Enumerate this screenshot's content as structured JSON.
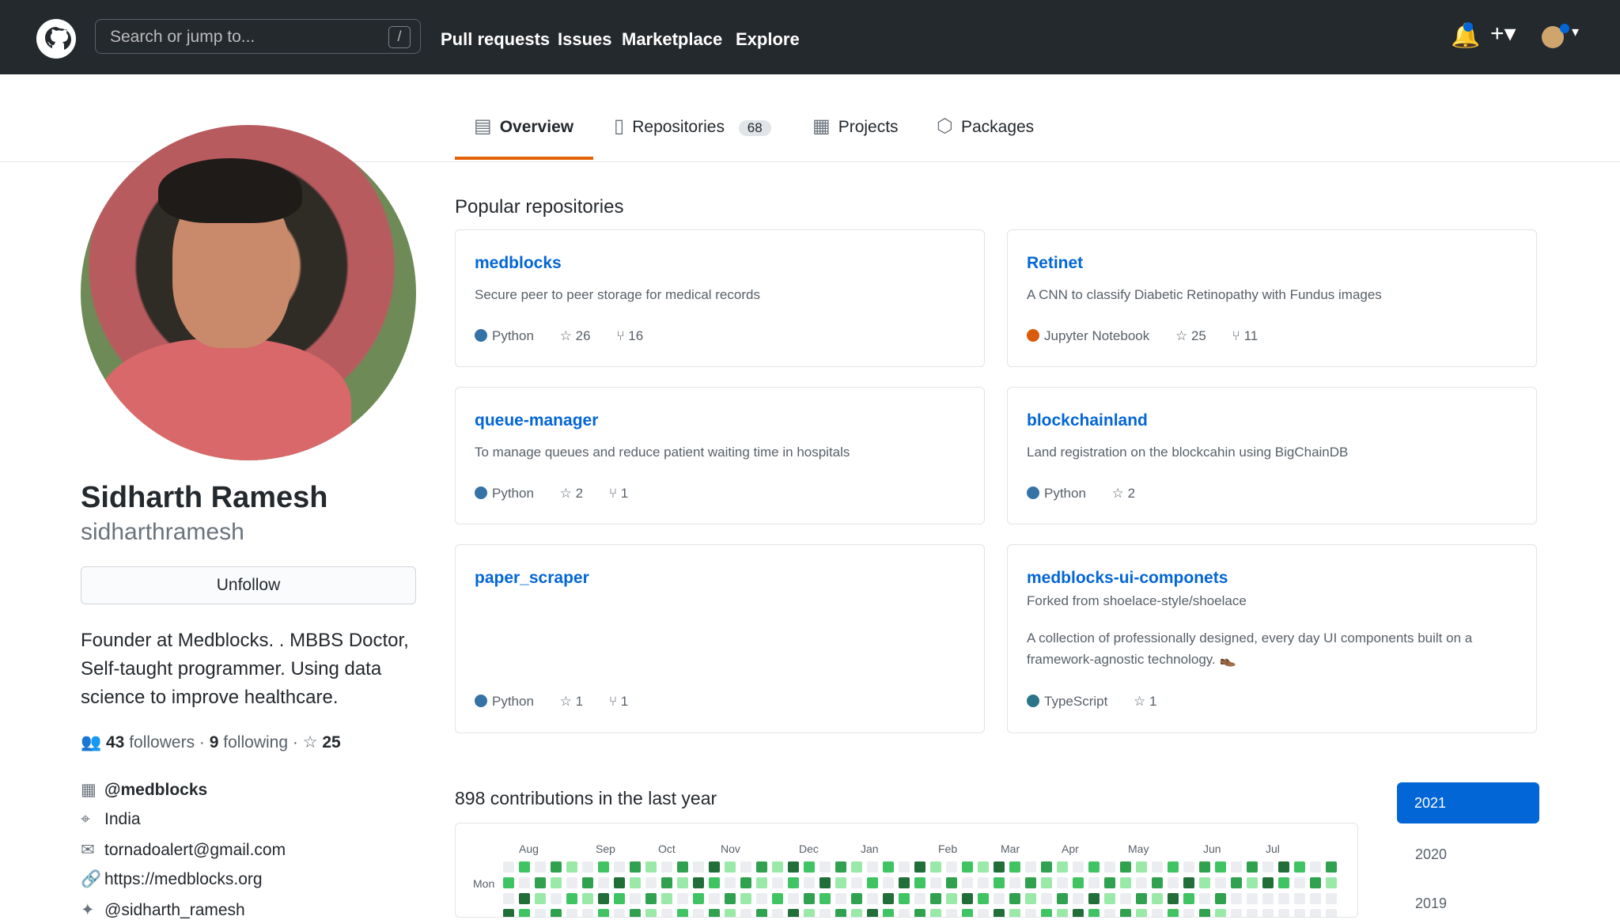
{
  "header": {
    "search_placeholder": "Search or jump to...",
    "slash_key": "/",
    "nav": [
      "Pull requests",
      "Issues",
      "Marketplace",
      "Explore"
    ],
    "icons": [
      "github-logo",
      "bell-icon",
      "plus-icon",
      "user-avatar"
    ]
  },
  "tabs": {
    "overview": "Overview",
    "repositories": "Repositories",
    "repositories_count": "68",
    "projects": "Projects",
    "packages": "Packages"
  },
  "profile": {
    "name": "Sidharth Ramesh",
    "username": "sidharthramesh",
    "button": "Unfollow",
    "bio": "Founder at Medblocks. . MBBS Doctor, Self-taught programmer. Using data science to improve healthcare.",
    "followers_count": "43",
    "followers_label": "followers",
    "separator_1": "·",
    "following_count": "9",
    "following_label": "following",
    "separator_2": "·",
    "stars": "25",
    "organization": "@medblocks",
    "location": "India",
    "email": "tornadoalert@gmail.com",
    "website": "https://medblocks.org",
    "twitter": "@sidharth_ramesh"
  },
  "popular": {
    "title": "Popular repositories",
    "repos": [
      {
        "name": "medblocks",
        "description": "Secure peer to peer storage for medical records",
        "language": "Python",
        "language_color": "#3572A5",
        "stars": "26",
        "forks": "16"
      },
      {
        "name": "Retinet",
        "description": "A CNN to classify Diabetic Retinopathy with Fundus images",
        "language": "Jupyter Notebook",
        "language_color": "#DA5B0B",
        "stars": "25",
        "forks": "11"
      },
      {
        "name": "queue-manager",
        "description": "To manage queues and reduce patient waiting time in hospitals",
        "language": "Python",
        "language_color": "#3572A5",
        "stars": "2",
        "forks": "1"
      },
      {
        "name": "blockchainland",
        "description": "Land registration on the blockcahin using BigChainDB",
        "language": "Python",
        "language_color": "#3572A5",
        "stars": "2"
      },
      {
        "name": "paper_scraper",
        "description": "",
        "language": "Python",
        "language_color": "#3572A5",
        "stars": "1",
        "forks": "1"
      },
      {
        "name": "medblocks-ui-componets",
        "forked_from": "Forked from shoelace-style/shoelace",
        "description": "A collection of professionally designed, every day UI components built on a framework-agnostic technology.",
        "language": "TypeScript",
        "language_color": "#2b7489",
        "stars": "1"
      }
    ]
  },
  "contributions": {
    "title": "898 contributions in the last year",
    "months": [
      "Aug",
      "Sep",
      "Oct",
      "Nov",
      "Dec",
      "Jan",
      "Feb",
      "Mar",
      "Apr",
      "May",
      "Jun",
      "Jul"
    ],
    "day_label": "Mon",
    "years": [
      "2021",
      "2020",
      "2019"
    ]
  }
}
